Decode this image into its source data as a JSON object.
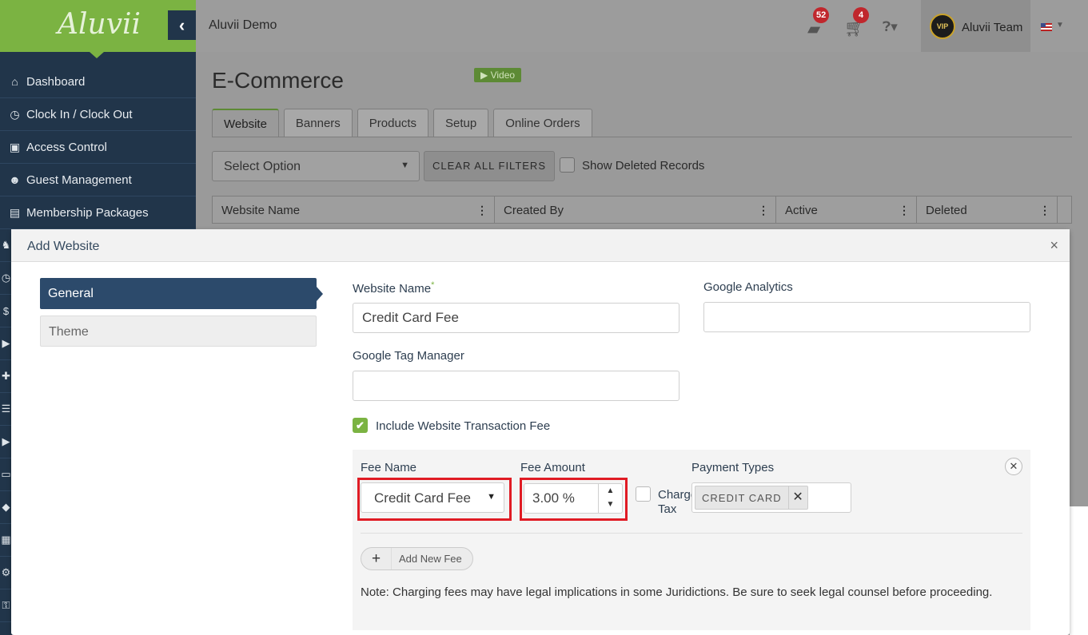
{
  "app": {
    "logo_text": "Aluvii",
    "collapse_icon": "chevron-left-icon"
  },
  "sidebar": {
    "items": [
      {
        "label": "Dashboard",
        "icon": "home-icon",
        "glyph": "⌂"
      },
      {
        "label": "Clock In / Clock Out",
        "icon": "clock-icon",
        "glyph": "◷"
      },
      {
        "label": "Access Control",
        "icon": "lock-icon",
        "glyph": "▣"
      },
      {
        "label": "Guest Management",
        "icon": "users-icon",
        "glyph": "☻"
      },
      {
        "label": "Membership Packages",
        "icon": "card-icon",
        "glyph": "▤"
      }
    ],
    "stub_icons": [
      "♞",
      "◷",
      "$",
      "▶",
      "✚",
      "☰",
      "▶",
      "▭",
      "◆",
      "▦",
      "⚙",
      "⚿",
      "⚙"
    ]
  },
  "topbar": {
    "org_name": "Aluvii Demo",
    "bag_badge": "52",
    "cart_badge": "4",
    "help_icon": "question-circle-icon",
    "user_name": "Aluvii Team",
    "avatar_text": "VIP",
    "language": "US flag"
  },
  "page": {
    "title": "E-Commerce",
    "video_label": "▶ Video",
    "tabs": [
      "Website",
      "Banners",
      "Products",
      "Setup",
      "Online Orders"
    ],
    "active_tab": "Website",
    "filter_select": "Select Option",
    "clear_filters": "CLEAR ALL FILTERS",
    "show_deleted": "Show Deleted Records",
    "grid_columns": [
      "Website Name",
      "Created By",
      "Active",
      "Deleted"
    ]
  },
  "modal": {
    "title": "Add Website",
    "close": "×",
    "side_tabs": [
      "General",
      "Theme"
    ],
    "website_name_label": "Website Name",
    "required_mark": "*",
    "website_name_value": "Credit Card Fee",
    "google_analytics_label": "Google Analytics",
    "google_analytics_value": "",
    "google_tag_label": "Google Tag Manager",
    "google_tag_value": "",
    "include_fee_label": "Include Website Transaction Fee",
    "include_fee_checked": true,
    "fee": {
      "name_label": "Fee Name",
      "name_value": "Credit Card Fee",
      "amount_label": "Fee Amount",
      "amount_value": "3.00 %",
      "charge_tax_label": "Charge Tax",
      "payment_types_label": "Payment Types",
      "payment_tags": [
        "CREDIT CARD"
      ],
      "add_new_fee": "Add New Fee",
      "note": "Note: Charging fees may have legal implications in some Juridictions. Be sure to seek legal counsel before proceeding."
    }
  },
  "colors": {
    "brand_green": "#7bb342",
    "sidebar": "#21354a",
    "highlight_red": "#e01b24",
    "badge_red": "#c0272d"
  }
}
